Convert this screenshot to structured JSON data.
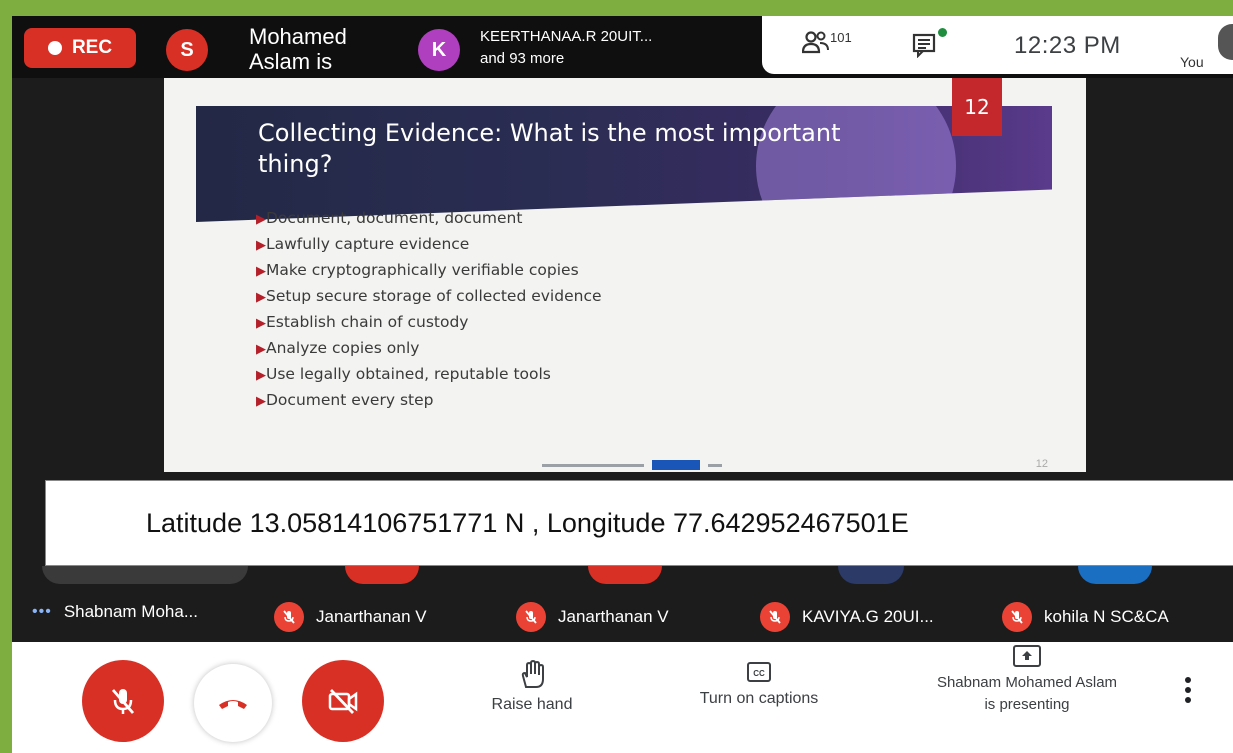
{
  "topbar": {
    "rec_label": "REC",
    "presenter_initial": "S",
    "presenter_name": "Mohamed Aslam is",
    "other_initial": "K",
    "other_name": "KEERTHANAA.R 20UIT...",
    "other_more": "and 93 more",
    "people_count": "101",
    "clock": "12:23 PM",
    "you_label": "You"
  },
  "slide": {
    "title": "Collecting Evidence: What is the most important thing?",
    "number": "12",
    "bullets": [
      "Document, document, document",
      "Lawfully capture evidence",
      "Make cryptographically verifiable copies",
      "Setup secure storage of collected evidence",
      "Establish chain of custody",
      "Analyze copies only",
      "Use legally obtained, reputable tools",
      "Document every step"
    ],
    "page_label": "12",
    "colors": {
      "banner": "#2a2d52",
      "accent": "#c4282c"
    }
  },
  "location": {
    "text": "Latitude 13.05814106751771 N , Longitude 77.642952467501E"
  },
  "participants": [
    {
      "name": "Shabnam Moha...",
      "icon": "more-dots-icon"
    },
    {
      "name": "Janarthanan V",
      "icon": "mic-off-icon"
    },
    {
      "name": "Janarthanan V",
      "icon": "mic-off-icon"
    },
    {
      "name": "KAVIYA.G 20UI...",
      "icon": "mic-off-icon"
    },
    {
      "name": "kohila N SC&CA",
      "icon": "mic-off-icon"
    }
  ],
  "controls": {
    "raise_hand": "Raise hand",
    "captions": "Turn on captions",
    "presenting_line1": "Shabnam Mohamed Aslam",
    "presenting_line2": "is presenting",
    "colors": {
      "danger": "#d93025"
    }
  }
}
